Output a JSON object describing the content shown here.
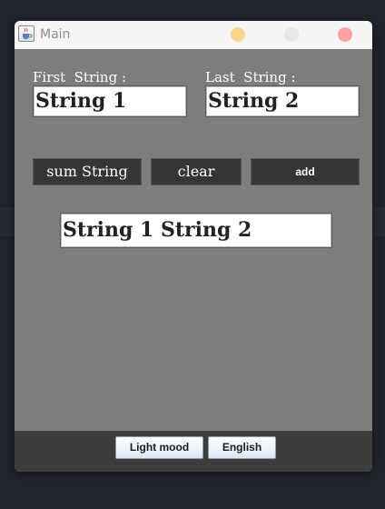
{
  "window": {
    "title": "Main",
    "app_icon": "java-cup-icon",
    "controls": {
      "minimize_color": "#fad58c",
      "maximize_color": "#e7e7e7",
      "close_color": "#fba2a2"
    }
  },
  "form": {
    "first_label": "First  String :",
    "first_value": "String 1",
    "last_label": "Last  String :",
    "last_value": "String 2"
  },
  "buttons": {
    "sum_label": "sum String",
    "clear_label": "clear",
    "add_label": "add"
  },
  "result": {
    "value": "String 1 String 2"
  },
  "footer": {
    "light_mode_label": "Light mood",
    "language_label": "English"
  },
  "colors": {
    "content_bg": "#7d7d7d",
    "dark_button": "#353535",
    "footer_bg": "#3c3c3c"
  }
}
